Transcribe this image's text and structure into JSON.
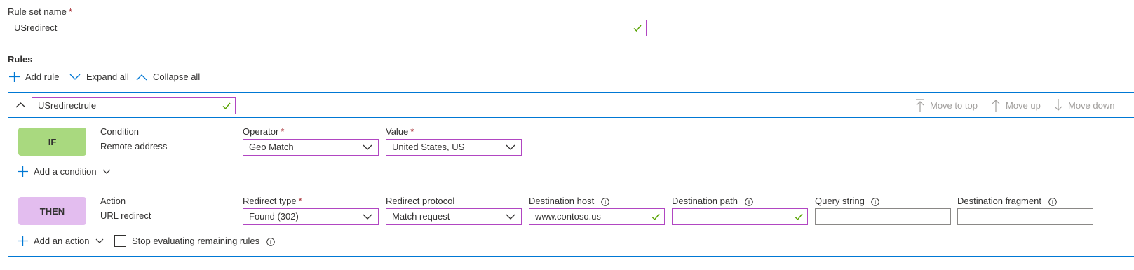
{
  "ruleset": {
    "label": "Rule set name",
    "required": "*",
    "value": "USredirect"
  },
  "rules_section": {
    "title": "Rules",
    "add_rule": "Add rule",
    "expand_all": "Expand all",
    "collapse_all": "Collapse all"
  },
  "rule": {
    "name": "USredirectrule",
    "move_to_top": "Move to top",
    "move_up": "Move up",
    "move_down": "Move down",
    "if_block": {
      "badge": "IF",
      "kind_label": "Condition",
      "kind_value": "Remote address",
      "operator_label": "Operator",
      "operator_value": "Geo Match",
      "value_label": "Value",
      "value_value": "United States, US",
      "add_condition": "Add a condition"
    },
    "then_block": {
      "badge": "THEN",
      "kind_label": "Action",
      "kind_value": "URL redirect",
      "redirect_type_label": "Redirect type",
      "redirect_type_value": "Found (302)",
      "redirect_protocol_label": "Redirect protocol",
      "redirect_protocol_value": "Match request",
      "destination_host_label": "Destination host",
      "destination_host_value": "www.contoso.us",
      "destination_path_label": "Destination path",
      "destination_path_value": "",
      "query_string_label": "Query string",
      "query_string_value": "",
      "destination_fragment_label": "Destination fragment",
      "destination_fragment_value": "",
      "add_action": "Add an action",
      "stop_evaluating": "Stop evaluating remaining rules"
    }
  },
  "colors": {
    "accent_blue": "#0078d4",
    "active_border": "#b146c2",
    "valid_check": "#57a300",
    "if_badge": "#a9d97f",
    "then_badge": "#e3bdef",
    "required_star": "#a4262c",
    "disabled_text": "#a19f9d"
  },
  "icons": [
    "check-icon",
    "chevron-down-icon",
    "chevron-up-icon",
    "plus-icon",
    "info-icon",
    "arrow-up-to-top-icon",
    "arrow-up-icon",
    "arrow-down-icon"
  ]
}
